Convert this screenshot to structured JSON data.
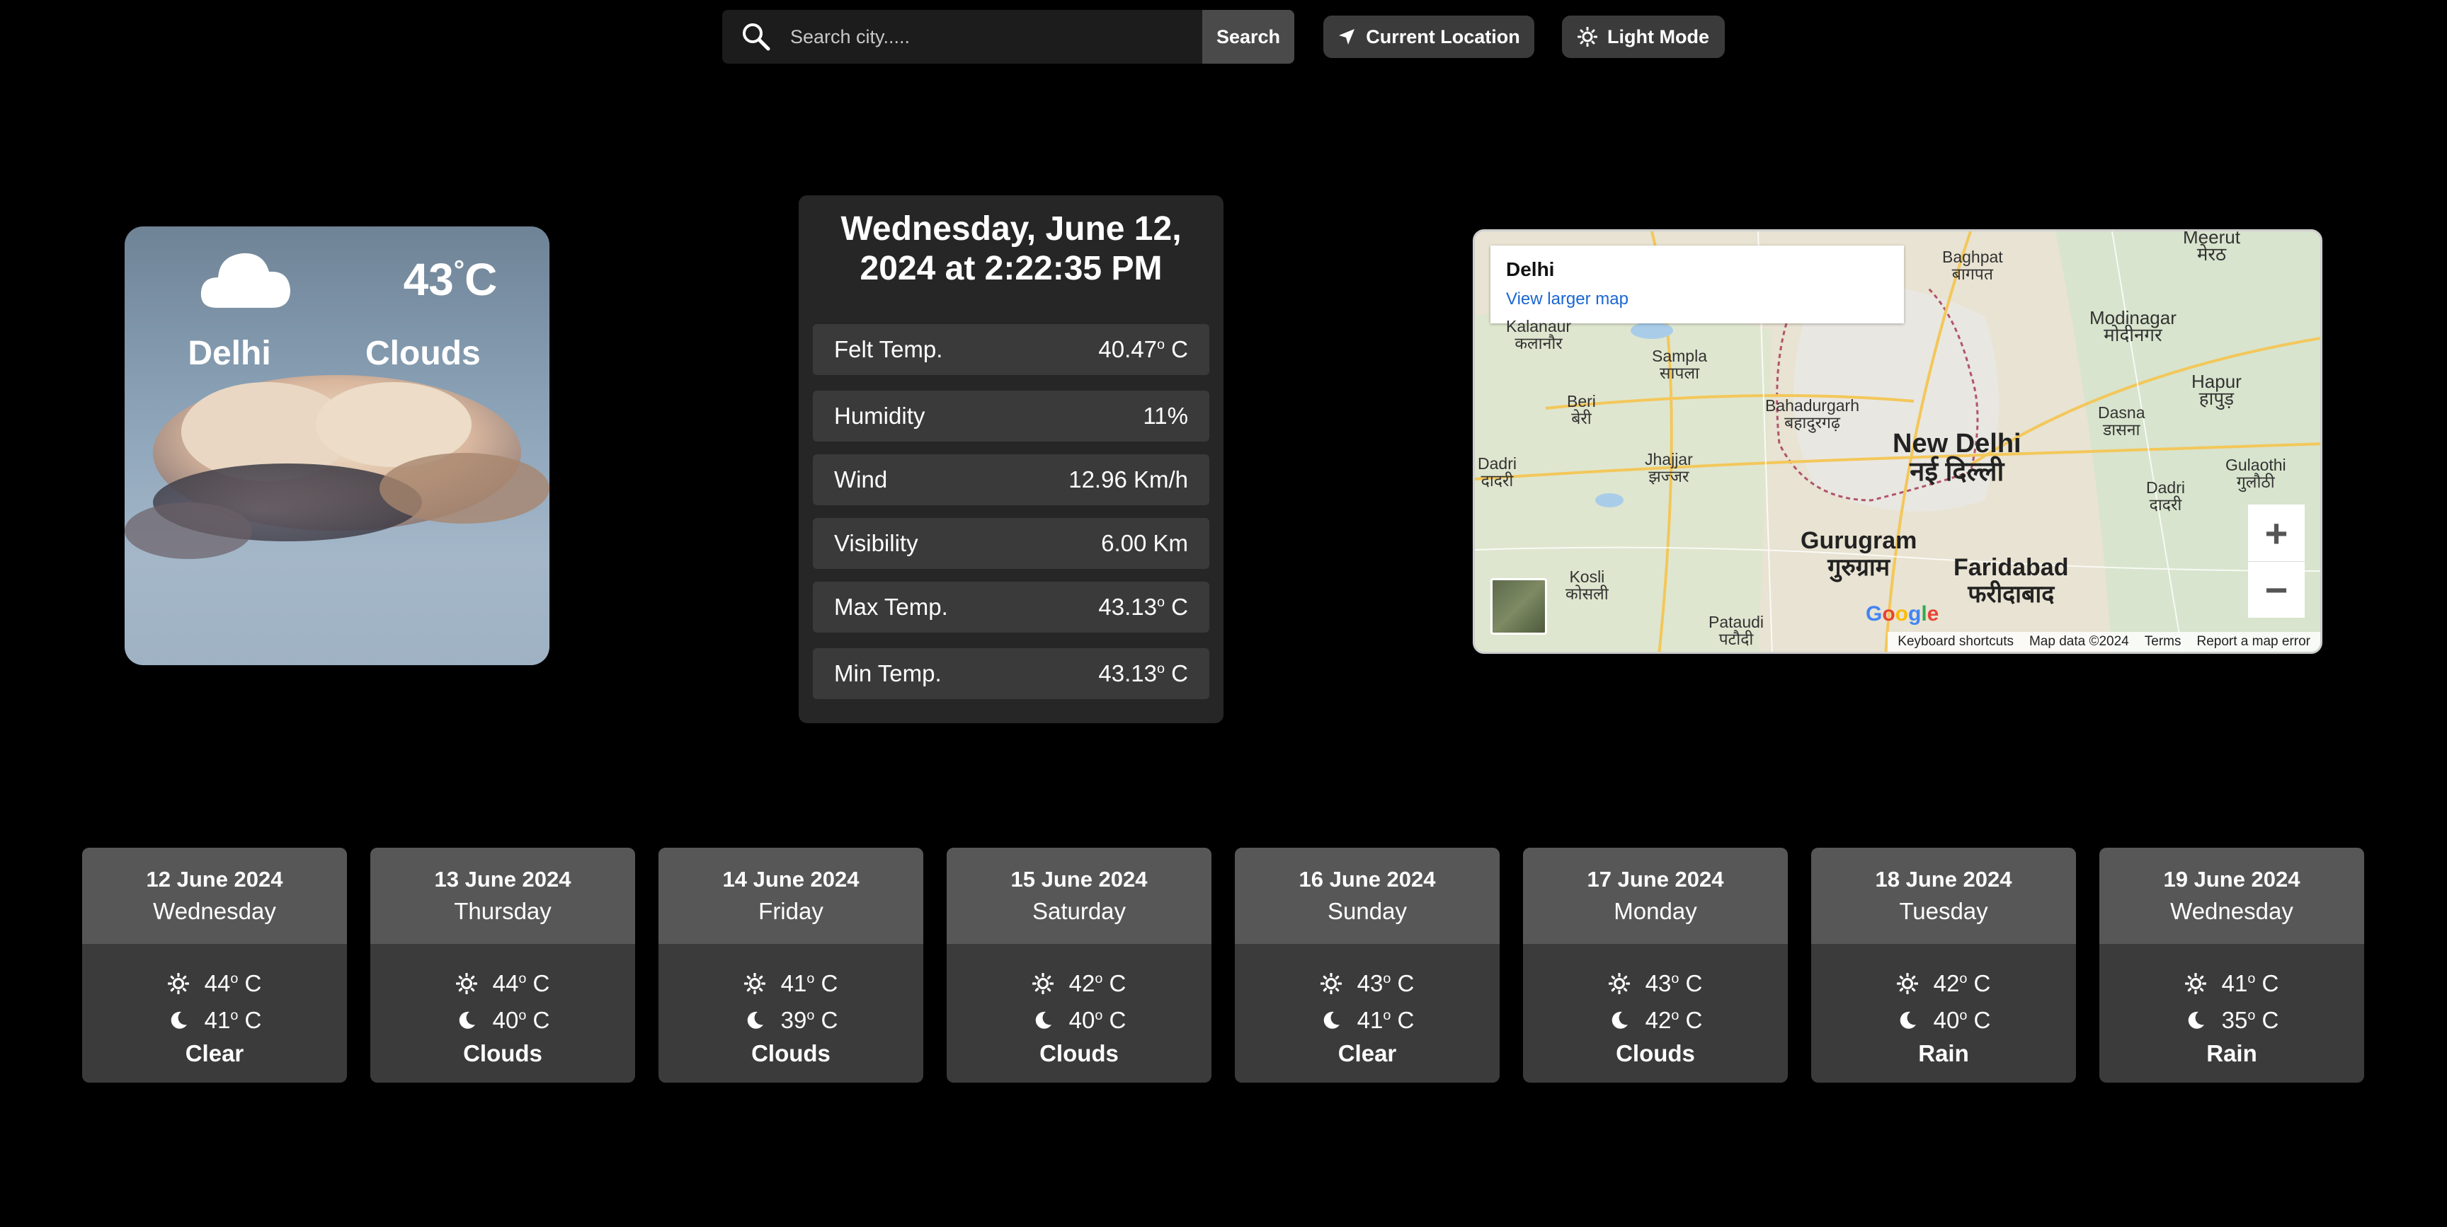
{
  "search": {
    "placeholder": "Search city.....",
    "button_label": "Search"
  },
  "buttons": {
    "current_location": "Current Location",
    "light_mode": "Light Mode"
  },
  "current": {
    "city": "Delhi",
    "temp": "43",
    "unit": "C",
    "condition": "Clouds",
    "icon": "cloud-icon"
  },
  "details": {
    "datetime_line1": "Wednesday, June 12,",
    "datetime_line2": "2024 at 2:22:35 PM",
    "rows": [
      {
        "label": "Felt Temp.",
        "value": "40.47",
        "unit": " C",
        "deg": true
      },
      {
        "label": "Humidity",
        "value": "11%",
        "unit": "",
        "deg": false
      },
      {
        "label": "Wind",
        "value": "12.96 Km/h",
        "unit": "",
        "deg": false
      },
      {
        "label": "Visibility",
        "value": "6.00 Km",
        "unit": "",
        "deg": false
      },
      {
        "label": "Max Temp.",
        "value": "43.13",
        "unit": " C",
        "deg": true
      },
      {
        "label": "Min Temp.",
        "value": "43.13",
        "unit": " C",
        "deg": true
      }
    ]
  },
  "map": {
    "popup_title": "Delhi",
    "popup_link": "View larger map",
    "labels": {
      "new_delhi_en": "New Delhi",
      "new_delhi_hi": "नई दिल्ली",
      "gurugram_en": "Gurugram",
      "gurugram_hi": "गुरुग्राम",
      "faridabad_en": "Faridabad",
      "faridabad_hi": "फरीदाबाद",
      "bahadurgarh": "Bahadurgarh\nबहादुरगढ़",
      "jhajjar": "Jhajjar\nझज्जर",
      "sampla": "Sampla\nसापला",
      "beri": "Beri\nबेरी",
      "dadri_w": "Dadri\nदादरी",
      "kosli": "Kosli\nकोसली",
      "pataudi": "Pataudi\nपटौदी",
      "kalanaur": "Kalanaur\nकलानौर",
      "baghpat": "Baghpat\nबागपत",
      "modinagar": "Modinagar\nमोदीनगर",
      "hapur": "Hapur\nहापुड़",
      "dasna": "Dasna\nडासना",
      "dadri_e": "Dadri\nदादरी",
      "gulaothi": "Gulaothi\nगुलौठी",
      "meerut": "Meerut\nमेरठ"
    },
    "footer": [
      "Keyboard shortcuts",
      "Map data ©2024",
      "Terms",
      "Report a map error"
    ],
    "zoom_in": "+",
    "zoom_out": "−",
    "logo": "Google"
  },
  "forecast": [
    {
      "date": "12 June 2024",
      "day": "Wednesday",
      "day_temp": "44",
      "night_temp": "41",
      "condition": "Clear"
    },
    {
      "date": "13 June 2024",
      "day": "Thursday",
      "day_temp": "44",
      "night_temp": "40",
      "condition": "Clouds"
    },
    {
      "date": "14 June 2024",
      "day": "Friday",
      "day_temp": "41",
      "night_temp": "39",
      "condition": "Clouds"
    },
    {
      "date": "15 June 2024",
      "day": "Saturday",
      "day_temp": "42",
      "night_temp": "40",
      "condition": "Clouds"
    },
    {
      "date": "16 June 2024",
      "day": "Sunday",
      "day_temp": "43",
      "night_temp": "41",
      "condition": "Clear"
    },
    {
      "date": "17 June 2024",
      "day": "Monday",
      "day_temp": "43",
      "night_temp": "42",
      "condition": "Clouds"
    },
    {
      "date": "18 June 2024",
      "day": "Tuesday",
      "day_temp": "42",
      "night_temp": "40",
      "condition": "Rain"
    },
    {
      "date": "19 June 2024",
      "day": "Wednesday",
      "day_temp": "41",
      "night_temp": "35",
      "condition": "Rain"
    }
  ],
  "forecast_unit": " C",
  "colors": {
    "background": "#000000",
    "panel": "#262626",
    "row": "#3a3a3a",
    "card_head": "#575757",
    "card_body": "#3b3b3b",
    "link": "#1a66d2"
  }
}
